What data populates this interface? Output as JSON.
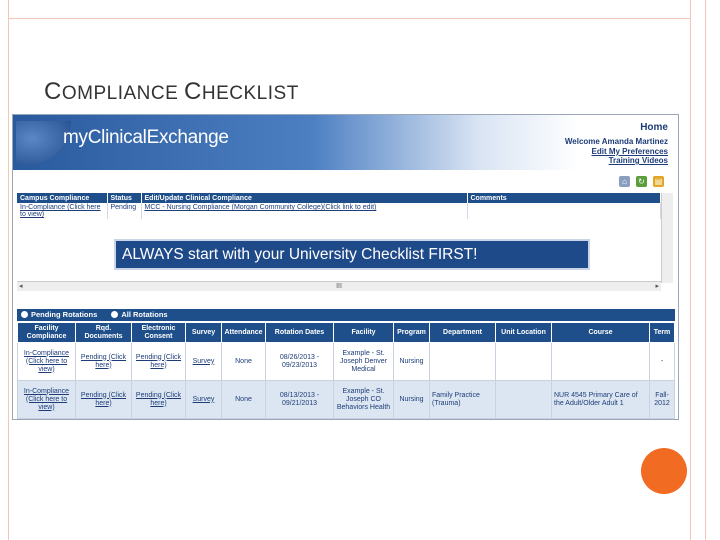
{
  "slide": {
    "title_first_cap": "C",
    "title_first_rest": "OMPLIANCE ",
    "title_second_cap": "C",
    "title_second_rest": "HECKLIST"
  },
  "header": {
    "logo_text": "myClinicalExchange",
    "home_link": "Home",
    "welcome": "Welcome Amanda Martinez",
    "preferences_link": "Edit My Preferences",
    "training_link": "Training Videos"
  },
  "compliance_table": {
    "columns": [
      "Campus Compliance",
      "Status",
      "Edit/Update Clinical Compliance",
      "Comments"
    ],
    "row": {
      "campus": "In-Compliance (Click here to view)",
      "status": "Pending",
      "edit": "MCC - Nursing Compliance (Morgan Community College)(Click link to edit)",
      "comments": ""
    }
  },
  "callout": {
    "text": "ALWAYS start with your University Checklist FIRST!"
  },
  "scrollbar": {
    "thumb": "III"
  },
  "rotations": {
    "tabs": [
      "Pending Rotations",
      "All Rotations"
    ],
    "columns": [
      "Facility Compliance",
      "Rqd. Documents",
      "Electronic Consent",
      "Survey",
      "Attendance",
      "Rotation Dates",
      "Facility",
      "Program",
      "Department",
      "Unit Location",
      "Course",
      "Term"
    ],
    "rows": [
      {
        "facility_compliance": "In-Compliance (Click here to view)",
        "rqd_documents": "Pending (Click here)",
        "electronic_consent": "Pending (Click here)",
        "survey": "Survey",
        "attendance": "None",
        "rotation_dates": "08/26/2013 - 09/23/2013",
        "facility": "Example - St. Joseph Denver Medical",
        "program": "Nursing",
        "department": "",
        "unit_location": "",
        "course": "",
        "term": "-"
      },
      {
        "facility_compliance": "In-Compliance (Click here to view)",
        "rqd_documents": "Pending (Click here)",
        "electronic_consent": "Pending (Click here)",
        "survey": "Survey",
        "attendance": "None",
        "rotation_dates": "08/13/2013 - 09/21/2013",
        "facility": "Example - St. Joseph CO Behaviors Health",
        "program": "Nursing",
        "department": "Family Practice (Trauma)",
        "unit_location": "",
        "course": "NUR 4545 Primary Care of the Adult/Older Adult 1",
        "term": "Fall-2012"
      }
    ]
  }
}
